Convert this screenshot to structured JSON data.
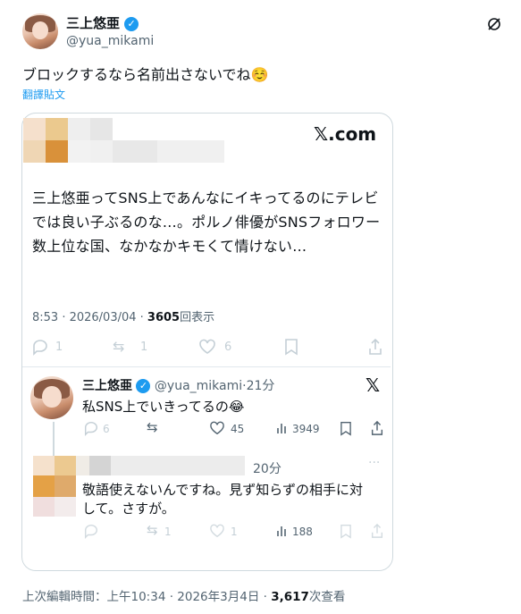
{
  "tweet": {
    "display_name": "三上悠亜",
    "handle": "@yua_mikami",
    "text": "ブロックするなら名前出さないでね☺️",
    "translate_link": "翻譯貼文"
  },
  "embedded": {
    "brand": "𝕏.com",
    "text": "三上悠亜ってSNS上であんなにイキってるのにテレビでは良い子ぶるのな…。ポルノ俳優がSNSフォロワー数上位な国、なかなかキモくて情けない…",
    "time": "8:53 · 2026/03/04 · ",
    "views_count": "3605",
    "views_label": "回表示",
    "actions": {
      "reply": "1",
      "retweet": "1",
      "like": "6"
    },
    "reply1": {
      "display_name": "三上悠亜",
      "handle": "@yua_mikami",
      "time": "·21分",
      "text": "私SNS上でいきってるの😂",
      "actions": {
        "reply": "6",
        "like": "45",
        "views": "3949"
      }
    },
    "reply2": {
      "time": "20分",
      "text_line1": "敬語使えないんですね。見ず知らずの相手に対",
      "text_line2": "して。さすが。",
      "actions": {
        "retweet": "1",
        "like": "1",
        "views": "188"
      },
      "more": "···"
    }
  },
  "footer": {
    "edited_label": "上次編輯時間：",
    "timestamp": "上午10:34 · 2026年3月4日 · ",
    "views_count": "3,617",
    "views_label": "次查看"
  },
  "colors": {
    "accent": "#1d9bf0",
    "text": "#0f1419",
    "muted": "#536471",
    "border": "#cfd9de"
  }
}
